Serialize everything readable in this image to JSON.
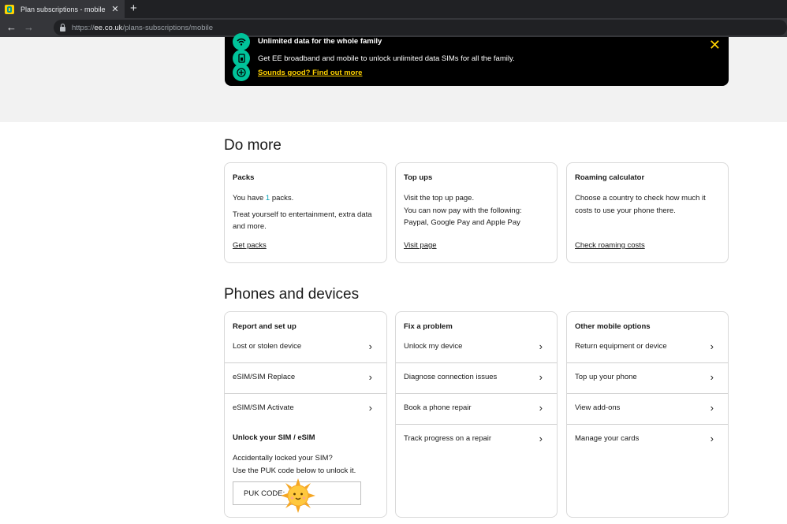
{
  "browser": {
    "tab_title": "Plan subscriptions - mobile",
    "tab_close": "✕",
    "new_tab": "+",
    "back": "←",
    "forward": "→",
    "url_prefix": "https://",
    "url_domain": "ee.co.uk",
    "url_path": "/plans-subscriptions/mobile"
  },
  "banner": {
    "title": "Unlimited data for the whole family",
    "text": "Get EE broadband and mobile to unlock unlimited data SIMs for all the family.",
    "link": "Sounds good? Find out more",
    "close": "✕"
  },
  "do_more": {
    "heading": "Do more",
    "cards": [
      {
        "title": "Packs",
        "line1_pre": "You have ",
        "line1_count": "1",
        "line1_post": " packs.",
        "line2": "Treat yourself to entertainment, extra data and more.",
        "link": "Get packs"
      },
      {
        "title": "Top ups",
        "line1": "Visit the top up page.",
        "line2": "You can now pay with the following: Paypal, Google Pay and Apple Pay",
        "link": "Visit page"
      },
      {
        "title": "Roaming calculator",
        "line1": "Choose a country to check how much it costs to use your phone there.",
        "link": "Check roaming costs"
      }
    ]
  },
  "phones": {
    "heading": "Phones and devices",
    "col1": {
      "title": "Report and set up",
      "rows": [
        "Lost or stolen device",
        "eSIM/SIM Replace",
        "eSIM/SIM Activate"
      ],
      "unlock_title": "Unlock your SIM / eSIM",
      "unlock_line1": "Accidentally locked your SIM?",
      "unlock_line2": "Use the PUK code below to unlock it.",
      "puk_label": "PUK CODE:"
    },
    "col2": {
      "title": "Fix a problem",
      "rows": [
        "Unlock my device",
        "Diagnose connection issues",
        "Book a phone repair",
        "Track progress on a repair"
      ]
    },
    "col3": {
      "title": "Other mobile options",
      "rows": [
        "Return equipment or device",
        "Top up your phone",
        "View add-ons",
        "Manage your cards"
      ]
    },
    "chevron": "›"
  },
  "colors": {
    "accent": "#ffd200",
    "teal": "#00c39a",
    "count": "#00a0b4"
  }
}
